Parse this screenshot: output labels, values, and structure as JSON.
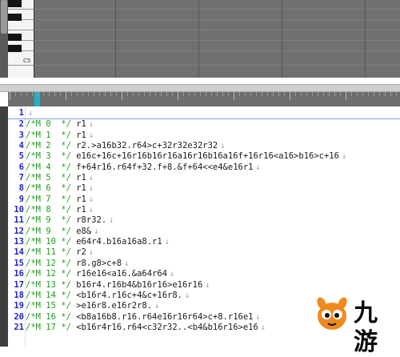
{
  "piano_roll": {
    "octave_label": "C5"
  },
  "editor": {
    "lines": [
      {
        "n": "1",
        "comment": "",
        "code": "",
        "current": true
      },
      {
        "n": "2",
        "comment": "/*M 0  */",
        "code": "r1"
      },
      {
        "n": "3",
        "comment": "/*M 1  */",
        "code": "r1"
      },
      {
        "n": "4",
        "comment": "/*M 2  */",
        "code": "r2.>a16b32.r64>c+32r32e32r32"
      },
      {
        "n": "5",
        "comment": "/*M 3  */",
        "code": "e16c+16c+16r16b16r16a16r16b16a16f+16r16<a16>b16>c+16"
      },
      {
        "n": "6",
        "comment": "/*M 4  */",
        "code": "f+64r16.r64f+32.f+8.&f+64<<e4&e16r1"
      },
      {
        "n": "7",
        "comment": "/*M 5  */",
        "code": "r1"
      },
      {
        "n": "8",
        "comment": "/*M 6  */",
        "code": "r1"
      },
      {
        "n": "9",
        "comment": "/*M 7  */",
        "code": "r1"
      },
      {
        "n": "10",
        "comment": "/*M 8  */",
        "code": "r1"
      },
      {
        "n": "11",
        "comment": "/*M 9  */",
        "code": "r8r32."
      },
      {
        "n": "12",
        "comment": "/*M 9  */",
        "code": "e8&"
      },
      {
        "n": "13",
        "comment": "/*M 10 */",
        "code": "e64r4.b16a16a8.r1"
      },
      {
        "n": "14",
        "comment": "/*M 11 */",
        "code": "r2"
      },
      {
        "n": "15",
        "comment": "/*M 12 */",
        "code": "r8.g8>c+8"
      },
      {
        "n": "16",
        "comment": "/*M 12 */",
        "code": "r16e16<a16.&a64r64"
      },
      {
        "n": "17",
        "comment": "/*M 13 */",
        "code": "b16r4.r16b4&b16r16>e16r16"
      },
      {
        "n": "18",
        "comment": "/*M 14 */",
        "code": "<b16r4.r16c+4&c+16r8."
      },
      {
        "n": "19",
        "comment": "/*M 15 */",
        "code": ">e16r8.e16r2r8."
      },
      {
        "n": "20",
        "comment": "/*M 16 */",
        "code": "<b8a16b8.r16.r64e16r16r64>c+8.r16e1"
      },
      {
        "n": "21",
        "comment": "/*M 17 */",
        "code": "<b16r4r16.r64<c32r32..<b4&b16r16>e16"
      }
    ],
    "eol_marker": "↓"
  },
  "watermark": {
    "text": "九游",
    "colors": {
      "logo": "#f08a1e",
      "eye": "#ffffff",
      "pupil": "#111111"
    }
  },
  "colors": {
    "line_number": "#2222cc",
    "comment": "#239a23",
    "ruler_cursor": "#1cb4c8"
  }
}
